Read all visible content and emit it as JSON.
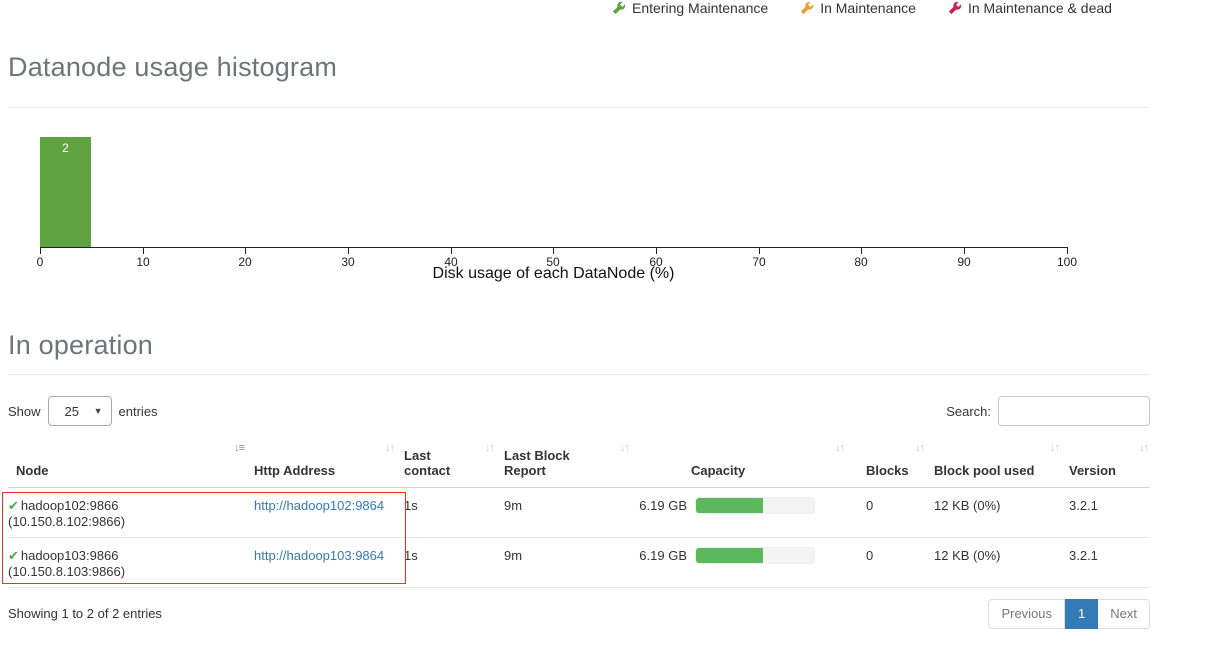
{
  "legend": {
    "items": [
      {
        "icon": "wrench-icon",
        "label": "Entering Maintenance",
        "color": "#5fa341"
      },
      {
        "icon": "wrench-icon",
        "label": "In Maintenance",
        "color": "#e9a135"
      },
      {
        "icon": "wrench-icon",
        "label": "In Maintenance & dead",
        "color": "#c9254c"
      }
    ]
  },
  "histogram_section": {
    "title": "Datanode usage histogram"
  },
  "chart_data": {
    "type": "bar",
    "title": "Datanode usage histogram",
    "xlabel": "Disk usage of each DataNode (%)",
    "ylabel": "",
    "xlim": [
      0,
      100
    ],
    "bin_width": 5,
    "bars": [
      {
        "x_range": [
          0,
          5
        ],
        "count": 2
      }
    ],
    "bar_label": "2",
    "bar_color": "#5fa341",
    "tick_labels": [
      "0",
      "10",
      "20",
      "30",
      "40",
      "50",
      "60",
      "70",
      "80",
      "90",
      "100"
    ],
    "grid": false,
    "legend_position": "none"
  },
  "operation_section": {
    "title": "In operation"
  },
  "table": {
    "show_label": "Show",
    "page_size": "25",
    "entries_label": "entries",
    "search_label": "Search:",
    "search_value": "",
    "columns": [
      {
        "label": "Node",
        "sorted": "asc"
      },
      {
        "label": "Http Address",
        "sorted": "none"
      },
      {
        "label": "Last contact",
        "sorted": "none"
      },
      {
        "label": "Last Block Report",
        "sorted": "none"
      },
      {
        "label": "Capacity",
        "sorted": "none"
      },
      {
        "label": "Blocks",
        "sorted": "none"
      },
      {
        "label": "Block pool used",
        "sorted": "none"
      },
      {
        "label": "Version",
        "sorted": "none"
      }
    ],
    "rows": [
      {
        "status_icon": "check-icon",
        "node": "hadoop102:9866",
        "node_ip": "(10.150.8.102:9866)",
        "http_address": "http://hadoop102:9864",
        "last_contact": "1s",
        "last_block_report": "9m",
        "capacity": "6.19 GB",
        "capacity_used_pct": 57,
        "blocks": "0",
        "block_pool_used": "12 KB (0%)",
        "version": "3.2.1"
      },
      {
        "status_icon": "check-icon",
        "node": "hadoop103:9866",
        "node_ip": "(10.150.8.103:9866)",
        "http_address": "http://hadoop103:9864",
        "last_contact": "1s",
        "last_block_report": "9m",
        "capacity": "6.19 GB",
        "capacity_used_pct": 57,
        "blocks": "0",
        "block_pool_used": "12 KB (0%)",
        "version": "3.2.1"
      }
    ],
    "footer_status": "Showing 1 to 2 of 2 entries",
    "pagination": {
      "previous_label": "Previous",
      "current_page": "1",
      "next_label": "Next"
    }
  },
  "colors": {
    "link": "#337ab7",
    "pagination_active": "#337ab7",
    "capacity_bar_fill": "#5cb85c",
    "histogram_bar": "#5fa341",
    "node_check": "#4ca64c",
    "annotation_box": "#ee3124",
    "heading_text": "#707478"
  }
}
